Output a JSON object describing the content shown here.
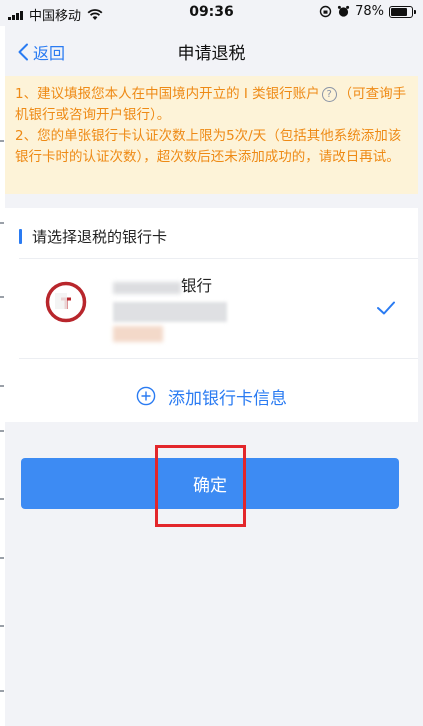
{
  "status_bar": {
    "carrier": "中国移动",
    "time": "09:36",
    "battery": "78%",
    "battery_level": 0.78
  },
  "nav": {
    "back_label": "返回",
    "title": "申请退税"
  },
  "notice": {
    "line1_a": "1、建议填报您本人在中国境内开立的 I 类银行账户",
    "line1_b": "（可查询手机银行或咨询开户银行）。",
    "line2": "2、您的单张银行卡认证次数上限为5次/天（包括其他系统添加该银行卡时的认证次数），超次数后还未添加成功的，请改日再试。",
    "help_glyph": "?"
  },
  "bank_section": {
    "heading": "请选择退税的银行卡"
  },
  "bank_card": {
    "name_suffix": "银行",
    "selected": true
  },
  "add_card": {
    "label": "添加银行卡信息"
  },
  "confirm": {
    "label": "确定"
  },
  "colors": {
    "accent": "#2a7bf2",
    "button": "#3d8bf3",
    "notice_bg": "#fdf3d8",
    "notice_text": "#ee8a15",
    "highlight": "#e3262b"
  },
  "icons": {
    "back": "chevron-left-icon",
    "check": "check-icon",
    "add": "plus-circle-icon",
    "help": "question-circle-icon"
  }
}
